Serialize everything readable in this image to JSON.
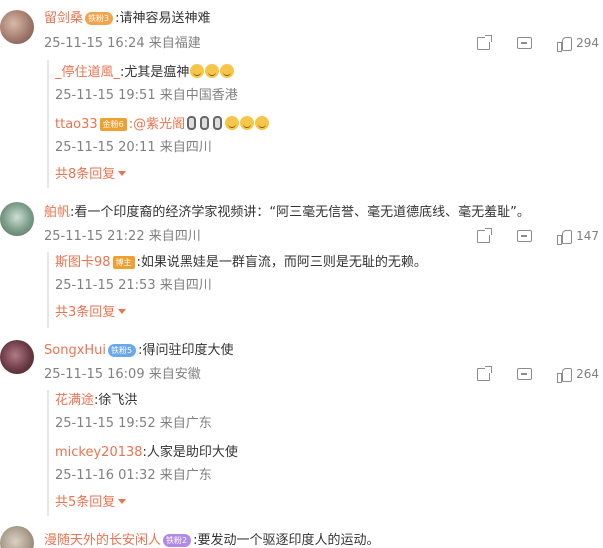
{
  "comments": [
    {
      "user": "留剑桑",
      "badge": "铁粉3",
      "text": ":请神容易送神难",
      "time": "25-11-15 16:24 来自福建",
      "likes": "294",
      "replies": [
        {
          "user": "_停住道風_",
          "text": ":尤其是瘟神",
          "time": "25-11-15 19:51 来自中国香港"
        },
        {
          "user": "ttao33",
          "badge": "金粉6",
          "text": ":@紫光阁",
          "time": "25-11-15 20:11 来自四川"
        }
      ],
      "more": "共8条回复"
    },
    {
      "user": "舶帆",
      "text": ":看一个印度裔的经济学家视频讲：“阿三毫无信誉、毫无道德底线、毫无羞耻”。",
      "time": "25-11-15 21:22 来自四川",
      "likes": "147",
      "replies": [
        {
          "user": "斯图卡98",
          "badge": "博主",
          "text": ":如果说黑娃是一群盲流，而阿三则是无耻的无赖。",
          "time": "25-11-15 21:53 来自四川"
        }
      ],
      "more": "共3条回复"
    },
    {
      "user": "SongxHui",
      "badge": "铁粉5",
      "text": ":得问驻印度大使",
      "time": "25-11-15 16:09 来自安徽",
      "likes": "264",
      "replies": [
        {
          "user": "花满途",
          "text": ":徐飞洪",
          "time": "25-11-15 19:52 来自广东"
        },
        {
          "user": "mickey20138",
          "text": ":人家是助印大使",
          "time": "25-11-16 01:32 来自广东"
        }
      ],
      "more": "共5条回复"
    },
    {
      "user": "漫随天外的长安闲人",
      "badge": "铁粉2",
      "text": ":要发动一个驱逐印度人的运动。"
    }
  ]
}
